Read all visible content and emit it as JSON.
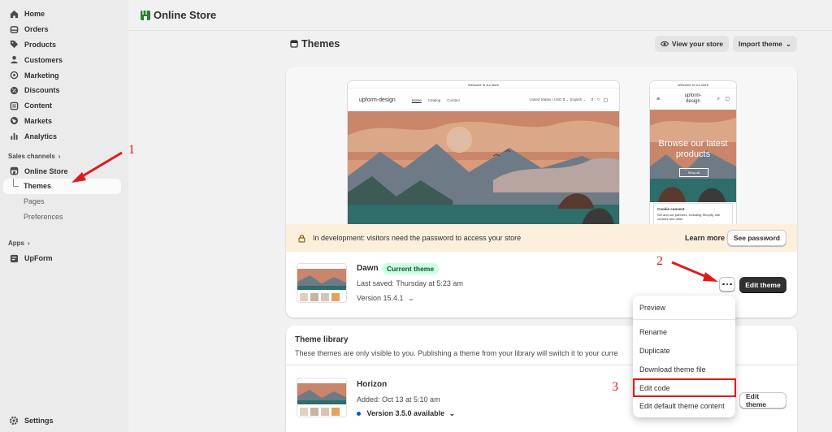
{
  "sidebar": {
    "items": [
      {
        "label": "Home",
        "icon": "home-icon"
      },
      {
        "label": "Orders",
        "icon": "orders-icon"
      },
      {
        "label": "Products",
        "icon": "tag-icon"
      },
      {
        "label": "Customers",
        "icon": "person-icon"
      },
      {
        "label": "Marketing",
        "icon": "target-icon"
      },
      {
        "label": "Discounts",
        "icon": "discount-icon"
      },
      {
        "label": "Content",
        "icon": "content-icon"
      },
      {
        "label": "Markets",
        "icon": "globe-icon"
      },
      {
        "label": "Analytics",
        "icon": "bar-chart-icon"
      }
    ],
    "sales_channels_label": "Sales channels",
    "online_store_label": "Online Store",
    "sub_items": [
      "Themes",
      "Pages",
      "Preferences"
    ],
    "apps_label": "Apps",
    "upform_label": "UpForm",
    "settings_label": "Settings"
  },
  "topbar": {
    "title": "Online Store"
  },
  "page": {
    "title": "Themes",
    "view_store_label": "View your store",
    "import_theme_label": "Import theme"
  },
  "preview": {
    "announcement": "Welcome to our store",
    "desktop_logo": "upform-design",
    "desktop_links": [
      "Home",
      "Catalog",
      "Contact"
    ],
    "desktop_right": "United States | USD $  ⌄   English  ⌄",
    "mobile_logo_line1": "upform-",
    "mobile_logo_line2": "design",
    "mobile_hero_line1": "Browse our latest",
    "mobile_hero_line2": "products",
    "mobile_shop_all": "Shop all",
    "cookie_title": "Cookie consent",
    "cookie_text": "We and our partners, including Shopify, use cookies and other"
  },
  "banner": {
    "text": "In development: visitors need the password to access your store",
    "learn_more": "Learn more",
    "see_password": "See password"
  },
  "current_theme": {
    "name": "Dawn",
    "badge": "Current theme",
    "last_saved": "Last saved: Thursday at 5:23 am",
    "version": "Version 15.4.1",
    "edit_label": "Edit theme"
  },
  "library": {
    "title": "Theme library",
    "description": "These themes are only visible to you. Publishing a theme from your library will switch it to your curre",
    "theme": {
      "name": "Horizon",
      "added": "Added: Oct 13 at 5:10 am",
      "version": "Version 3.5.0 available",
      "edit_label": "Edit theme"
    }
  },
  "menu": {
    "items": [
      "Preview",
      "Rename",
      "Duplicate",
      "Download theme file",
      "Edit code",
      "Edit default theme content"
    ]
  },
  "annotations": [
    "1",
    "2",
    "3"
  ],
  "colors": {
    "annotation_red": "#e01a1a",
    "badge_green": "#cdfee1",
    "banner_bg": "#fcefdc",
    "dark_button": "#303030"
  }
}
